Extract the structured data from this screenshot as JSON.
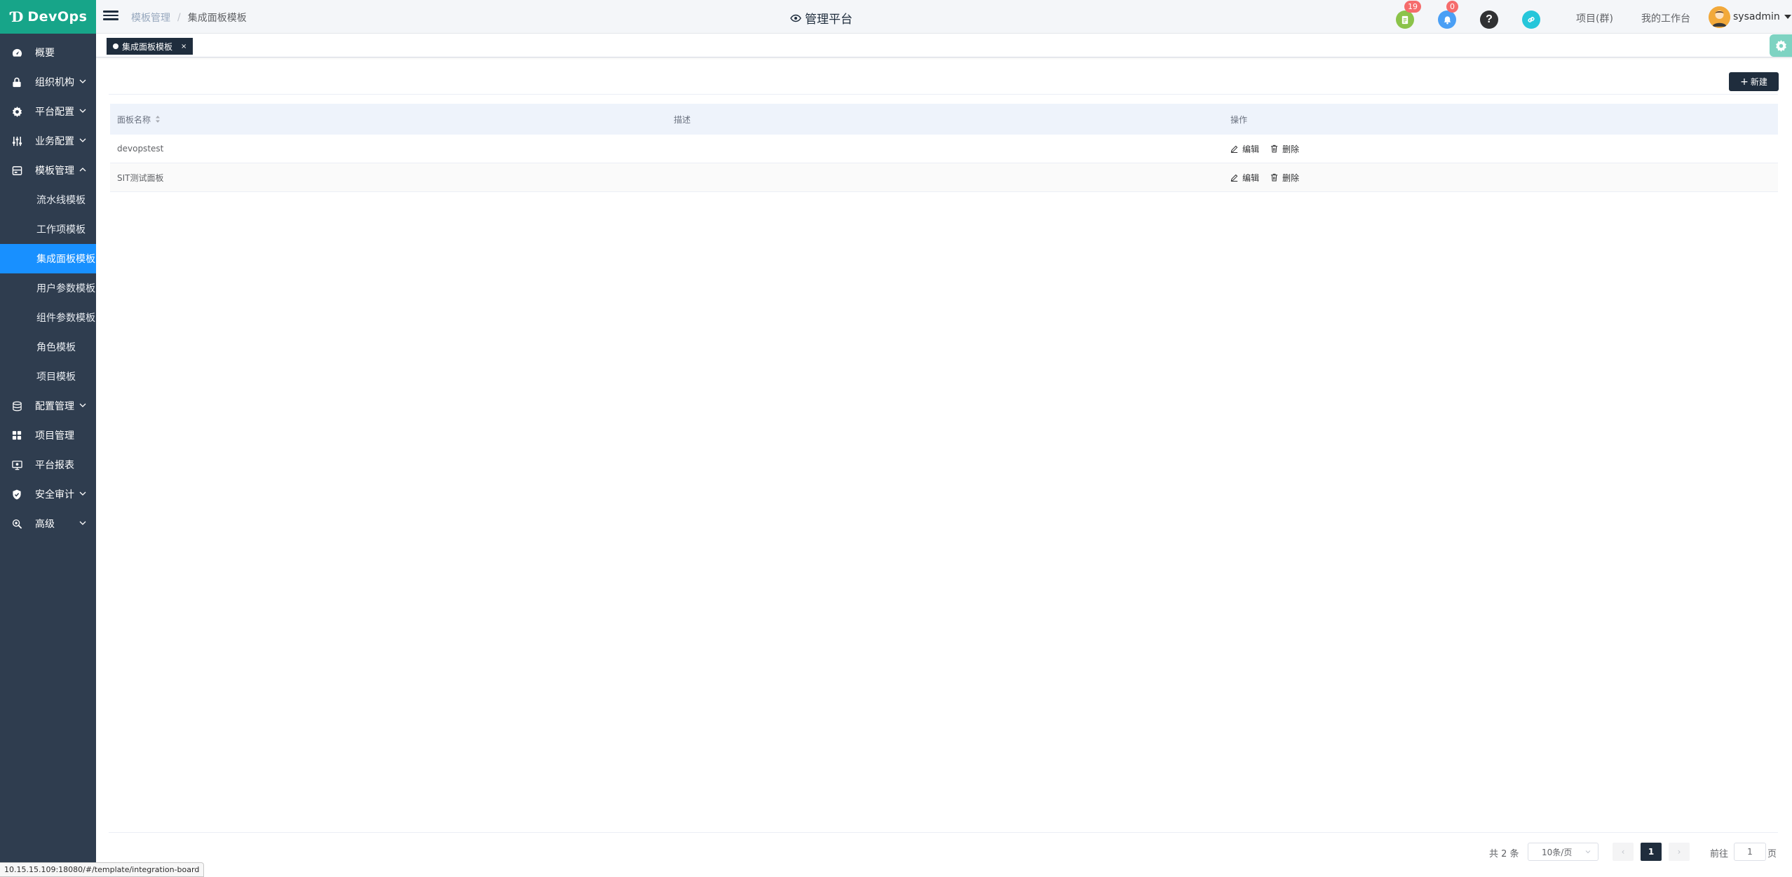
{
  "app": {
    "logo_mark": "Ɗ",
    "logo_text": "DevOps"
  },
  "sidebar": {
    "items": [
      {
        "label": "概要",
        "icon": "dashboard-icon",
        "expandable": false
      },
      {
        "label": "组织机构",
        "icon": "lock-icon",
        "expandable": true
      },
      {
        "label": "平台配置",
        "icon": "gear-icon",
        "expandable": true
      },
      {
        "label": "业务配置",
        "icon": "sliders-icon",
        "expandable": true
      },
      {
        "label": "模板管理",
        "icon": "template-icon",
        "expandable": true,
        "expanded": true
      },
      {
        "label": "配置管理",
        "icon": "database-icon",
        "expandable": true
      },
      {
        "label": "项目管理",
        "icon": "grid-icon",
        "expandable": false
      },
      {
        "label": "平台报表",
        "icon": "monitor-icon",
        "expandable": false
      },
      {
        "label": "安全审计",
        "icon": "shield-icon",
        "expandable": true
      },
      {
        "label": "高级",
        "icon": "advanced-icon",
        "expandable": true
      }
    ],
    "submenu": [
      {
        "label": "流水线模板",
        "active": false
      },
      {
        "label": "工作项模板",
        "active": false
      },
      {
        "label": "集成面板模板",
        "active": true
      },
      {
        "label": "用户参数模板",
        "active": false
      },
      {
        "label": "组件参数模板",
        "active": false
      },
      {
        "label": "角色模板",
        "active": false
      },
      {
        "label": "项目模板",
        "active": false
      }
    ]
  },
  "header": {
    "breadcrumb": [
      "模板管理",
      "集成面板模板"
    ],
    "separator": "/",
    "title": "管理平台",
    "badges": {
      "tasks": "19",
      "notifications": "0"
    },
    "links": [
      "项目(群)",
      "我的工作台"
    ],
    "username": "sysadmin"
  },
  "tags": {
    "active_tag": "集成面板模板",
    "close": "×"
  },
  "toolbar": {
    "new_label": "新建",
    "new_plus": "+"
  },
  "table": {
    "columns": [
      "面板名称",
      "描述",
      "操作"
    ],
    "rows": [
      {
        "name": "devopstest",
        "description": "",
        "edit": "编辑",
        "delete": "删除"
      },
      {
        "name": "SIT测试面板",
        "description": "",
        "edit": "编辑",
        "delete": "删除"
      }
    ]
  },
  "pagination": {
    "total": "共 2 条",
    "page_size": "10条/页",
    "current_page": "1",
    "goto_label": "前往",
    "goto_value": "1",
    "page_unit": "页",
    "prev": "‹",
    "next": "›"
  },
  "statusbar": {
    "url": "10.15.15.109:18080/#/template/integration-board"
  },
  "colors": {
    "sidebar_bg": "#2f3d4f",
    "logo_bg": "#17a589",
    "active_menu": "#1890ff",
    "dark_button": "#1f2d3d",
    "badge_red": "#f56c6c"
  }
}
